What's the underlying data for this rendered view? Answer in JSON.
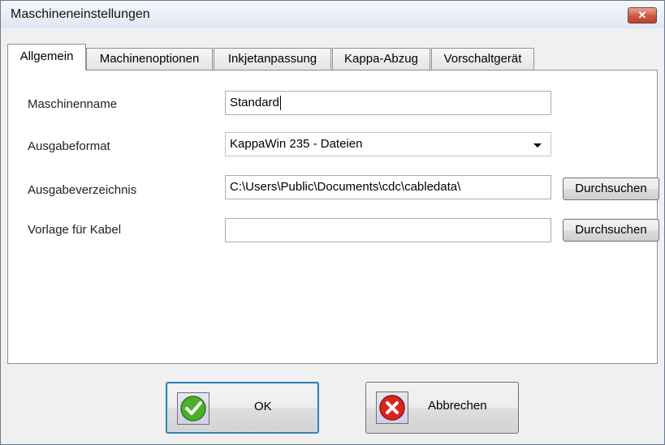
{
  "window": {
    "title": "Maschineneinstellungen",
    "close_glyph": "✕"
  },
  "tabs": [
    {
      "label": "Allgemein",
      "active": true
    },
    {
      "label": "Machinenoptionen",
      "active": false
    },
    {
      "label": "Inkjetanpassung",
      "active": false
    },
    {
      "label": "Kappa-Abzug",
      "active": false
    },
    {
      "label": "Vorschaltgerät",
      "active": false
    }
  ],
  "form": {
    "machine_name": {
      "label": "Maschinenname",
      "value": "Standard"
    },
    "output_format": {
      "label": "Ausgabeformat",
      "value": "KappaWin 235 - Dateien"
    },
    "output_dir": {
      "label": "Ausgabeverzeichnis",
      "value": "C:\\Users\\Public\\Documents\\cdc\\cabledata\\",
      "browse_label": "Durchsuchen"
    },
    "cable_template": {
      "label": "Vorlage für Kabel",
      "value": "",
      "browse_label": "Durchsuchen"
    }
  },
  "buttons": {
    "ok": {
      "label": "OK",
      "icon": "checkmark-icon",
      "color": "#4caf2a"
    },
    "cancel": {
      "label": "Abbrechen",
      "icon": "cancel-x-icon",
      "color": "#d9261c"
    }
  }
}
